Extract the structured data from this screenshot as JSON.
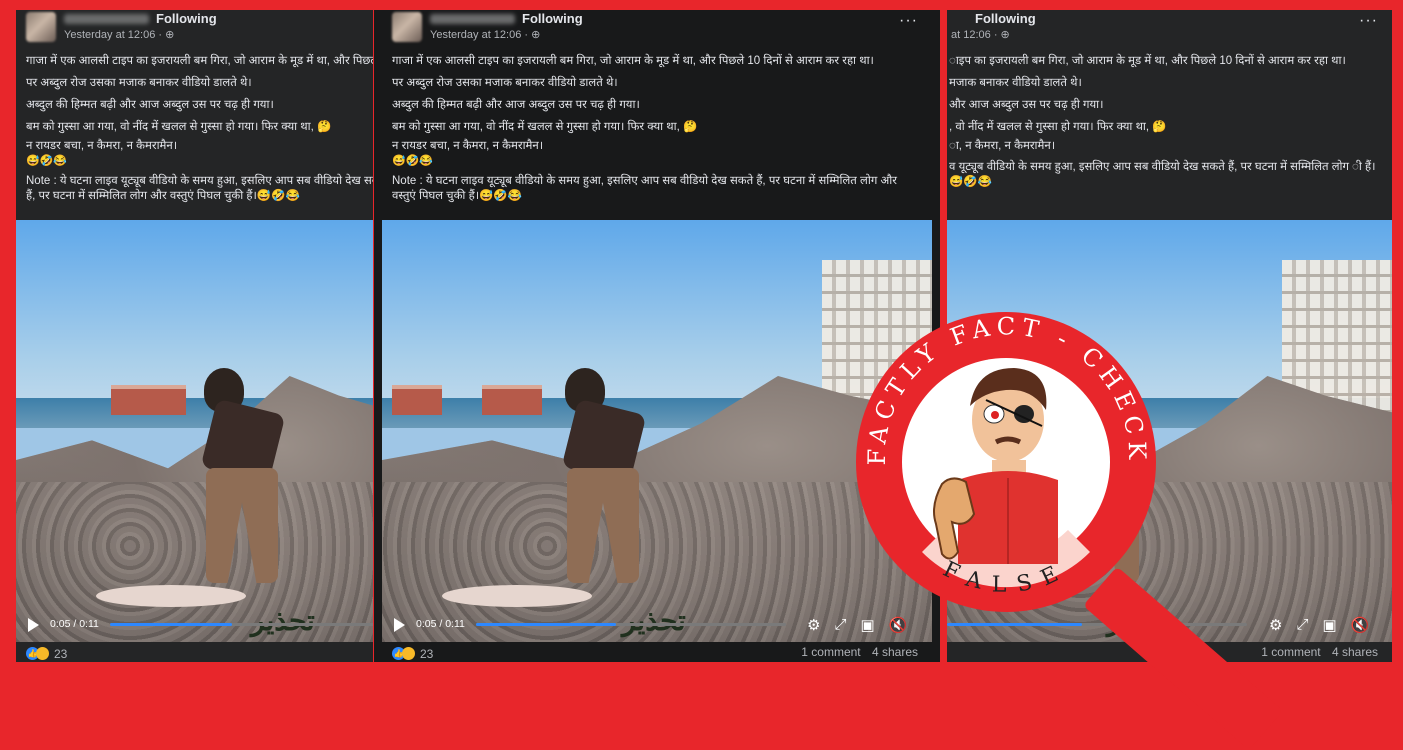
{
  "post": {
    "following_label": "Following",
    "timestamp": "Yesterday at 12:06 · ",
    "globe_icon": "globe-icon",
    "more_icon": "more-options-icon",
    "more_label": "···",
    "lines": [
      "गाजा में एक आलसी टाइप का इजरायली बम गिरा, जो आराम के मूड में था, और पिछले 10 दिनों से आराम कर रहा था।",
      "पर अब्दुल रोज उसका मजाक बनाकर वीडियो डालते थे।",
      "अब्दुल की हिम्मत बढ़ी और आज अब्दुल उस पर चढ़ ही गया।",
      "बम को गुस्सा आ गया, वो नींद में खलल से गुस्सा हो गया।  फिर क्या था, 🤔",
      "न रायडर बचा,  न कैमरा, न कैमरामैन।",
      "😅🤣😂"
    ],
    "note": "Note : ये घटना लाइव यूट्यूब वीडियो के समय हुआ, इसलिए आप सब वीडियो देख सकते हैं, पर घटना में सम्मिलित लोग और वस्तुएं पिघल चुकी हैं।😅🤣😂",
    "p3_lines": [
      "ाइप का इजरायली बम गिरा, जो आराम के मूड में था, और पिछले 10 दिनों से आराम कर रहा था।",
      " मजाक बनाकर वीडियो डालते थे।",
      " और आज अब्दुल उस पर चढ़ ही गया।",
      ", वो नींद में खलल से गुस्सा हो गया।  फिर क्या था, 🤔",
      "ा, न कैमरा, न कैमरामैन।",
      ""
    ],
    "p3_note": "व यूट्यूब वीडियो के समय हुआ, इसलिए आप सब वीडियो देख सकते हैं, पर घटना में सम्मिलित लोग ी हैं।😅🤣😂",
    "p3_timestamp": "at 12:06 · ",
    "video": {
      "time": "0:05 / 0:11",
      "progress": 0.45,
      "overlay_text": "تحذير"
    },
    "reactions": {
      "count": "23"
    },
    "comments": "1 comment",
    "shares": "4 shares"
  },
  "stamp": {
    "brand": "FACTLY FACT - CHECK",
    "verdict": "FALSE"
  },
  "colors": {
    "frame": "#e8262b",
    "panel": "#242526",
    "accent": "#2d88ff"
  }
}
